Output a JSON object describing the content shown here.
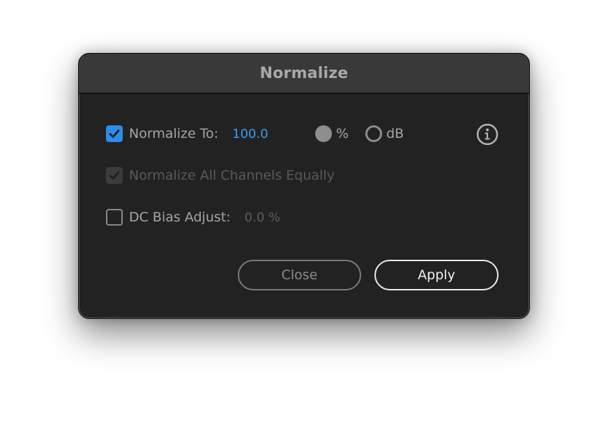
{
  "dialog": {
    "title": "Normalize"
  },
  "normalize_to": {
    "label": "Normalize To:",
    "checked": true,
    "value": "100.0",
    "unit_options": [
      {
        "label": "%",
        "selected": true
      },
      {
        "label": "dB",
        "selected": false
      }
    ],
    "info_icon": "info-icon"
  },
  "normalize_all_channels": {
    "label": "Normalize All Channels Equally",
    "checked": true,
    "disabled": true
  },
  "dc_bias": {
    "label": "DC Bias Adjust:",
    "checked": false,
    "value": "0.0 %"
  },
  "buttons": {
    "close_label": "Close",
    "apply_label": "Apply"
  },
  "colors": {
    "accent": "#2d8ceb",
    "value_blue": "#3d9bf2",
    "background": "#222222",
    "titlebar": "#393939"
  }
}
